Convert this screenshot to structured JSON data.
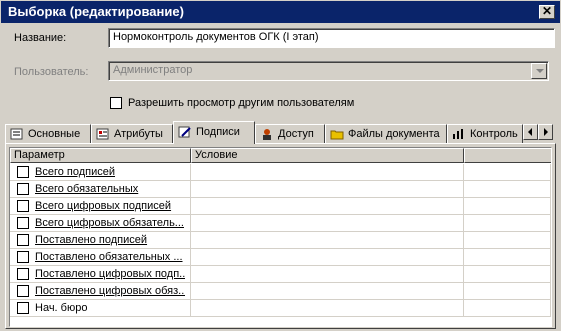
{
  "window": {
    "title": "Выборка (редактирование)",
    "close_glyph": "✕"
  },
  "form": {
    "name_label": "Название:",
    "name_value": "Нормоконтроль документов ОГК (I этап)",
    "user_label": "Пользователь:",
    "user_value": "Администратор",
    "allow_view_label": "Разрешить просмотр другим пользователям",
    "allow_view_checked": false
  },
  "tabs": [
    {
      "label": "Основные",
      "icon": "main-icon",
      "active": false
    },
    {
      "label": "Атрибуты",
      "icon": "attributes-icon",
      "active": false
    },
    {
      "label": "Подписи",
      "icon": "signatures-icon",
      "active": true
    },
    {
      "label": "Доступ",
      "icon": "access-icon",
      "active": false
    },
    {
      "label": "Файлы документа",
      "icon": "folder-icon",
      "active": false
    },
    {
      "label": "Контроль",
      "icon": "control-icon",
      "active": false
    }
  ],
  "grid": {
    "columns": [
      "Параметр",
      "Условие",
      ""
    ],
    "rows": [
      {
        "param": "Всего подписей",
        "condition": ""
      },
      {
        "param": "Всего обязательных",
        "condition": ""
      },
      {
        "param": "Всего цифровых подписей",
        "condition": ""
      },
      {
        "param": "Всего цифровых обязатель...",
        "condition": ""
      },
      {
        "param": "Поставлено подписей",
        "condition": ""
      },
      {
        "param": "Поставлено обязательных ...",
        "condition": ""
      },
      {
        "param": "Поставлено цифровых подп...",
        "condition": ""
      },
      {
        "param": "Поставлено цифровых обяз...",
        "condition": ""
      },
      {
        "param": "Нач. бюро",
        "condition": ""
      }
    ]
  },
  "colors": {
    "titlebar": "#0a246a",
    "face": "#d4d0c8"
  }
}
